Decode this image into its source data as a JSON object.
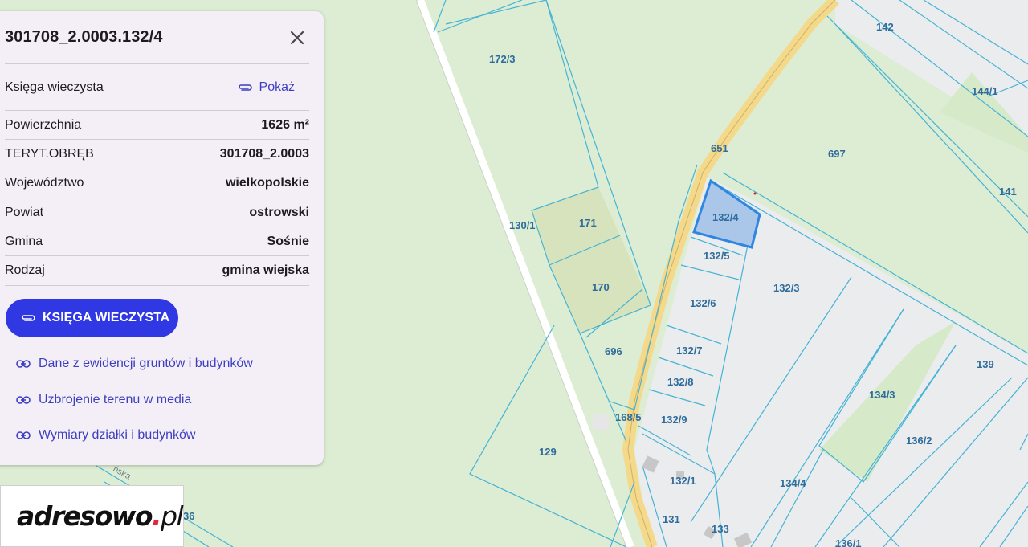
{
  "panel": {
    "title": "301708_2.0003.132/4",
    "land_register_label": "Księga wieczysta",
    "show_label": "Pokaż",
    "attributes": [
      {
        "label": "Powierzchnia",
        "value": "1626 m²"
      },
      {
        "label": "TERYT.OBRĘB",
        "value": "301708_2.0003"
      },
      {
        "label": "Województwo",
        "value": "wielkopolskie"
      },
      {
        "label": "Powiat",
        "value": "ostrowski"
      },
      {
        "label": "Gmina",
        "value": "Sośnie"
      },
      {
        "label": "Rodzaj",
        "value": "gmina wiejska"
      }
    ],
    "primary_button": "KSIĘGA WIECZYSTA",
    "links": [
      "Dane z ewidencji gruntów i budynków",
      "Uzbrojenie terenu w media",
      "Wymiary działki i budynków"
    ]
  },
  "logo": {
    "name": "adresowo",
    "dot": ".",
    "tld": "pl"
  },
  "map": {
    "selected_plot": "132/4",
    "plot_labels": [
      "142",
      "172/3",
      "144/1",
      "651",
      "697",
      "141",
      "132/4",
      "130/1",
      "171",
      "132/5",
      "132/3",
      "170",
      "132/6",
      "696",
      "132/7",
      "139",
      "132/8",
      "134/3",
      "168/5",
      "132/9",
      "136/2",
      "129",
      "132/1",
      "134/4",
      "131",
      "133",
      "136/1",
      "36"
    ],
    "street_fragment": "ńska",
    "colors": {
      "background": "#dcedd3",
      "parcel_line": "#45b3d6",
      "selected_fill": "#aac7ea",
      "selected_stroke": "#2f86e0",
      "road": "#f5d98b"
    }
  }
}
